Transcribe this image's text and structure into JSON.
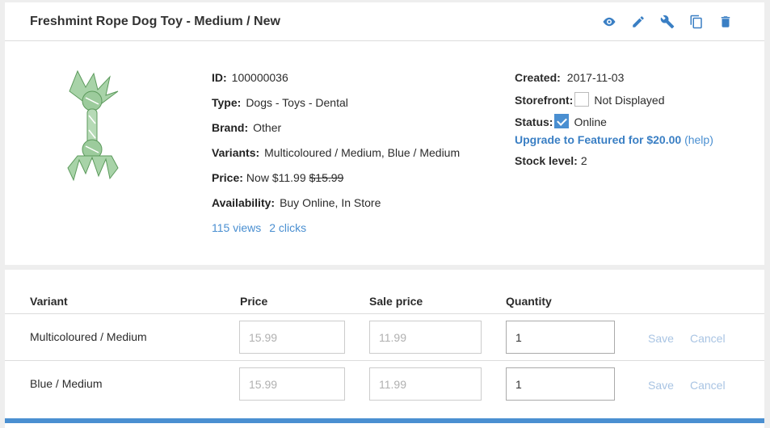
{
  "product": {
    "title": "Freshmint Rope Dog Toy - Medium / New",
    "id_label": "ID:",
    "id": "100000036",
    "type_label": "Type:",
    "type": "Dogs - Toys - Dental",
    "brand_label": "Brand:",
    "brand": "Other",
    "variants_label": "Variants:",
    "variants": "Multicoloured / Medium, Blue / Medium",
    "price_label": "Price:",
    "price_now": "Now $11.99",
    "price_was": "$15.99",
    "availability_label": "Availability:",
    "availability": "Buy Online, In Store",
    "views": "115 views",
    "clicks": "2 clicks"
  },
  "meta": {
    "created_label": "Created:",
    "created": "2017-11-03",
    "storefront_label": "Storefront:",
    "storefront": "Not Displayed",
    "storefront_checked": false,
    "status_label": "Status:",
    "status": "Online",
    "status_checked": true,
    "upgrade": "Upgrade to Featured for $20.00",
    "help": "(help)",
    "stock_label": "Stock level:",
    "stock": "2"
  },
  "actions": [
    "eye-icon",
    "pencil-icon",
    "wrench-icon",
    "copy-icon",
    "trash-icon"
  ],
  "table": {
    "headers": {
      "variant": "Variant",
      "price": "Price",
      "sale": "Sale price",
      "qty": "Quantity"
    },
    "rows": [
      {
        "name": "Multicoloured / Medium",
        "price_ph": "15.99",
        "sale_ph": "11.99",
        "qty": "1"
      },
      {
        "name": "Blue / Medium",
        "price_ph": "15.99",
        "sale_ph": "11.99",
        "qty": "1"
      }
    ],
    "save": "Save",
    "cancel": "Cancel"
  },
  "colors": {
    "accent": "#4a8fd1",
    "disabled_link": "#a9c4e3"
  }
}
